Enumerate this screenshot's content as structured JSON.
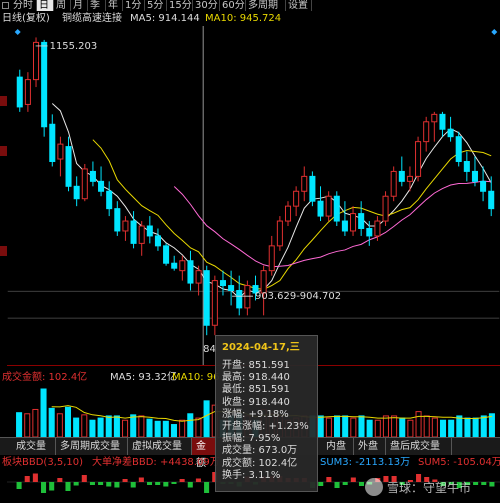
{
  "tabs": [
    {
      "label": "分时",
      "active": false
    },
    {
      "label": "日",
      "active": true
    },
    {
      "label": "周",
      "active": false
    },
    {
      "label": "月",
      "active": false
    },
    {
      "label": "季",
      "active": false
    },
    {
      "label": "年",
      "active": false
    },
    {
      "label": "1分",
      "active": false
    },
    {
      "label": "5分",
      "active": false
    },
    {
      "label": "15分",
      "active": false
    },
    {
      "label": "30分",
      "active": false
    },
    {
      "label": "60分",
      "active": false
    },
    {
      "label": "多周期",
      "active": false
    },
    {
      "label": "设置",
      "active": false
    }
  ],
  "info": {
    "period": "日线(复权)",
    "index_name": "铜缆高速连接",
    "ma5_label": "MA5: 914.144",
    "ma10_label": "MA10: 945.724"
  },
  "price_labels": {
    "high": "1155.203",
    "low_partial": "84",
    "range": "903.629-904.702"
  },
  "volume_info": {
    "label": "成交金额: 102.4亿",
    "ma5": "MA5: 93.32亿",
    "ma10": "MA10: 96"
  },
  "indicator_tabs": [
    "成交量",
    "多周期成交量",
    "虚拟成交量",
    "金额",
    "",
    "",
    "",
    "内盘",
    "外盘",
    "盘后成交量"
  ],
  "bbd_info": {
    "label": "板块BBD(3,5,10)",
    "big_net": "大单净差BBD: +4438.09万",
    "sum3": "SUM3: -2113.13万",
    "sum5": "SUM5: -105.04万"
  },
  "tooltip": {
    "date": "2024-04-17,三",
    "rows": [
      "开盘: 851.591",
      "最高: 918.440",
      "最低: 851.591",
      "收盘: 918.440",
      "涨幅: +9.18%",
      "开盘涨幅: +1.23%",
      "振幅: 7.95%",
      "成交量: 673.0万",
      "成交额: 102.4亿",
      "换手: 3.11%"
    ]
  },
  "watermark": "雪球：守望牛市",
  "colors": {
    "up": "#e03030",
    "down": "#00e5ff",
    "ma5": "#e8e8e8",
    "ma10": "#e8d800",
    "ma20": "#ff40ff",
    "ma_pink": "#ff6ad5",
    "accent_dark": "#7a0d0d"
  },
  "candles": [
    [
      1080,
      1095,
      1010,
      1020
    ],
    [
      1025,
      1090,
      1010,
      1075
    ],
    [
      1075,
      1160,
      1060,
      1150
    ],
    [
      1150,
      1155,
      960,
      980
    ],
    [
      985,
      1005,
      900,
      910
    ],
    [
      915,
      960,
      880,
      945
    ],
    [
      940,
      960,
      850,
      860
    ],
    [
      860,
      880,
      820,
      835
    ],
    [
      835,
      905,
      830,
      895
    ],
    [
      890,
      910,
      860,
      870
    ],
    [
      870,
      900,
      840,
      850
    ],
    [
      850,
      870,
      800,
      815
    ],
    [
      815,
      830,
      760,
      770
    ],
    [
      770,
      800,
      750,
      790
    ],
    [
      790,
      810,
      735,
      745
    ],
    [
      745,
      790,
      720,
      780
    ],
    [
      780,
      800,
      745,
      760
    ],
    [
      760,
      775,
      730,
      740
    ],
    [
      740,
      745,
      700,
      705
    ],
    [
      705,
      720,
      690,
      695
    ],
    [
      690,
      720,
      670,
      710
    ],
    [
      710,
      730,
      650,
      665
    ],
    [
      665,
      700,
      640,
      690
    ],
    [
      690,
      700,
      560,
      580
    ],
    [
      580,
      680,
      560,
      670
    ],
    [
      670,
      690,
      640,
      660
    ],
    [
      660,
      690,
      620,
      650
    ],
    [
      650,
      680,
      600,
      615
    ],
    [
      615,
      670,
      600,
      660
    ],
    [
      660,
      680,
      630,
      645
    ],
    [
      645,
      700,
      600,
      690
    ],
    [
      690,
      760,
      680,
      740
    ],
    [
      740,
      800,
      730,
      790
    ],
    [
      790,
      830,
      780,
      820
    ],
    [
      820,
      860,
      800,
      850
    ],
    [
      850,
      900,
      830,
      880
    ],
    [
      880,
      890,
      820,
      830
    ],
    [
      830,
      860,
      790,
      800
    ],
    [
      800,
      850,
      790,
      840
    ],
    [
      840,
      850,
      780,
      790
    ],
    [
      790,
      830,
      760,
      770
    ],
    [
      770,
      820,
      760,
      805
    ],
    [
      805,
      830,
      760,
      775
    ],
    [
      775,
      790,
      740,
      760
    ],
    [
      760,
      800,
      750,
      790
    ],
    [
      790,
      850,
      780,
      840
    ],
    [
      840,
      900,
      830,
      890
    ],
    [
      890,
      920,
      860,
      870
    ],
    [
      870,
      900,
      850,
      880
    ],
    [
      880,
      960,
      870,
      950
    ],
    [
      950,
      1000,
      930,
      990
    ],
    [
      990,
      1010,
      950,
      1005
    ],
    [
      1005,
      1010,
      960,
      975
    ],
    [
      975,
      1000,
      950,
      960
    ],
    [
      960,
      970,
      900,
      910
    ],
    [
      910,
      930,
      870,
      890
    ],
    [
      890,
      920,
      860,
      870
    ],
    [
      870,
      900,
      830,
      850
    ],
    [
      850,
      880,
      800,
      815
    ]
  ]
}
